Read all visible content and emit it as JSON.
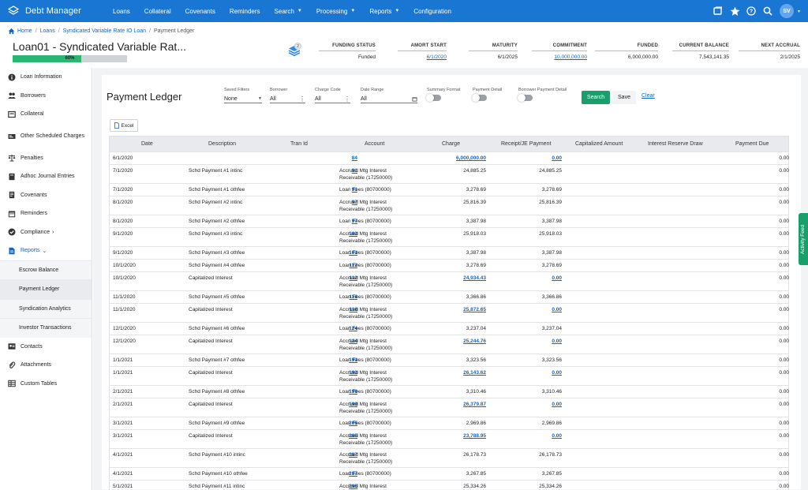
{
  "app": {
    "brand": "Debt Manager",
    "nav": [
      "Loans",
      "Collateral",
      "Covenants",
      "Reminders",
      "Search",
      "Processing",
      "Reports",
      "Configuration"
    ],
    "nav_caret": [
      false,
      false,
      false,
      false,
      true,
      true,
      true,
      false
    ],
    "avatar_initials": "SV",
    "accent_color": "#1976d2"
  },
  "breadcrumb": {
    "home": "Home",
    "loans": "Loans",
    "loan": "Syndicated Variable Rate IO Loan",
    "current": "Payment Ledger"
  },
  "loan": {
    "title": "Loan01 - Syndicated Variable Rat...",
    "progress_percent": 60,
    "progress_label": "60%",
    "badge_count": "2",
    "stats": [
      {
        "label": "FUNDING STATUS",
        "value": "Funded",
        "link": false
      },
      {
        "label": "AMORT START",
        "value": "6/1/2020",
        "link": true
      },
      {
        "label": "MATURITY",
        "value": "6/1/2025",
        "link": false
      },
      {
        "label": "COMMITMENT",
        "value": "10,000,000.00",
        "link": true
      },
      {
        "label": "FUNDED",
        "value": "6,000,000.00",
        "link": false
      },
      {
        "label": "CURRENT BALANCE",
        "value": "7,543,141.35",
        "link": false
      },
      {
        "label": "NEXT ACCRUAL",
        "value": "2/1/2025",
        "link": false
      }
    ]
  },
  "sidebar": {
    "items": [
      {
        "label": "Loan Information",
        "icon": "info-icon"
      },
      {
        "label": "Borrowers",
        "icon": "users-icon"
      },
      {
        "label": "Collateral",
        "icon": "collateral-icon"
      },
      {
        "label": "Other Scheduled Charges",
        "icon": "charges-icon"
      },
      {
        "label": "Penalties",
        "icon": "scale-icon"
      },
      {
        "label": "Adhoc Journal Entries",
        "icon": "journal-icon"
      },
      {
        "label": "Covenants",
        "icon": "covenant-icon"
      },
      {
        "label": "Reminders",
        "icon": "calendar-icon"
      },
      {
        "label": "Compliance",
        "icon": "compliance-icon"
      },
      {
        "label": "Reports",
        "icon": "reports-icon"
      }
    ],
    "report_sub": [
      "Escrow Balance",
      "Payment Ledger",
      "Syndication Analytics",
      "Investor Transactions"
    ],
    "items_after": [
      {
        "label": "Contacts",
        "icon": "contacts-icon"
      },
      {
        "label": "Attachments",
        "icon": "paperclip-icon"
      },
      {
        "label": "Custom Tables",
        "icon": "table-icon"
      }
    ]
  },
  "ledger": {
    "title": "Payment Ledger",
    "filters": {
      "saved_filters_label": "Saved Filters",
      "saved_filters_value": "None",
      "borrower_label": "Borrower",
      "borrower_value": "All",
      "charge_code_label": "Charge Code",
      "charge_code_value": "All",
      "date_range_label": "Date Range",
      "date_range_value": "All",
      "summary_format_label": "Summary Format",
      "payment_detail_label": "Payment Detail",
      "borrower_payment_detail_label": "Borrower Payment Detail"
    },
    "search_label": "Search",
    "save_label": "Save",
    "clear_label": "Clear",
    "excel_label": "Excel",
    "columns": [
      "Date",
      "Description",
      "Tran Id",
      "Account",
      "Charge",
      "Receipt/JE Payment",
      "Capitalized Amount",
      "Interest Reserve Draw",
      "Payment Due"
    ],
    "rows": [
      {
        "date": "6/1/2020",
        "desc": "",
        "tran": "84",
        "acct1": "",
        "acct2": "",
        "charge": "6,000,000.00",
        "charge_link": true,
        "receipt": "0.00",
        "receipt_link": true,
        "due": "0.00"
      },
      {
        "date": "7/1/2020",
        "desc": "Schd Payment #1 intinc",
        "tran": "91",
        "acct1": "Accrued Mtg Interest",
        "acct2": "Receivable (17250000)",
        "charge": "24,885.25",
        "charge_link": false,
        "receipt": "24,885.25",
        "receipt_link": false,
        "due": "0.00"
      },
      {
        "date": "7/1/2020",
        "desc": "Schd Payment #1 othfee",
        "tran": "91",
        "acct1": "Loan Fees (80700000)",
        "acct2": "",
        "charge": "3,278.69",
        "charge_link": false,
        "receipt": "3,278.69",
        "receipt_link": false,
        "due": "0.00"
      },
      {
        "date": "8/1/2020",
        "desc": "Schd Payment #2 intinc",
        "tran": "97",
        "acct1": "Accrued Mtg Interest",
        "acct2": "Receivable (17250000)",
        "charge": "25,816.39",
        "charge_link": false,
        "receipt": "25,816.39",
        "receipt_link": false,
        "due": "0.00"
      },
      {
        "date": "8/1/2020",
        "desc": "Schd Payment #2 othfee",
        "tran": "97",
        "acct1": "Loan Fees (80700000)",
        "acct2": "",
        "charge": "3,387.98",
        "charge_link": false,
        "receipt": "3,387.98",
        "receipt_link": false,
        "due": "0.00"
      },
      {
        "date": "9/1/2020",
        "desc": "Schd Payment #3 intinc",
        "tran": "103",
        "acct1": "Accrued Mtg Interest",
        "acct2": "Receivable (17250000)",
        "charge": "25,918.03",
        "charge_link": false,
        "receipt": "25,918.03",
        "receipt_link": false,
        "due": "0.00"
      },
      {
        "date": "9/1/2020",
        "desc": "Schd Payment #3 othfee",
        "tran": "103",
        "acct1": "Loan Fees (80700000)",
        "acct2": "",
        "charge": "3,387.98",
        "charge_link": false,
        "receipt": "3,387.98",
        "receipt_link": false,
        "due": "0.00"
      },
      {
        "date": "10/1/2020",
        "desc": "Schd Payment #4 othfee",
        "tran": "112",
        "acct1": "Loan Fees (80700000)",
        "acct2": "",
        "charge": "3,278.69",
        "charge_link": false,
        "receipt": "3,278.69",
        "receipt_link": false,
        "due": "0.00"
      },
      {
        "date": "10/1/2020",
        "desc": "Capitalized Interest",
        "tran": "112",
        "acct1": "Accrued Mtg Interest",
        "acct2": "Receivable (17250000)",
        "charge": "24,934.43",
        "charge_link": true,
        "receipt": "0.00",
        "receipt_link": true,
        "due": "0.00"
      },
      {
        "date": "11/1/2020",
        "desc": "Schd Payment #5 othfee",
        "tran": "118",
        "acct1": "Loan Fees (80700000)",
        "acct2": "",
        "charge": "3,366.86",
        "charge_link": false,
        "receipt": "3,366.86",
        "receipt_link": false,
        "due": "0.00"
      },
      {
        "date": "11/1/2020",
        "desc": "Capitalized Interest",
        "tran": "118",
        "acct1": "Accrued Mtg Interest",
        "acct2": "Receivable (17250000)",
        "charge": "25,872.65",
        "charge_link": true,
        "receipt": "0.00",
        "receipt_link": true,
        "due": "0.00"
      },
      {
        "date": "12/1/2020",
        "desc": "Schd Payment #6 othfee",
        "tran": "124",
        "acct1": "Loan Fees (80700000)",
        "acct2": "",
        "charge": "3,237.04",
        "charge_link": false,
        "receipt": "3,237.04",
        "receipt_link": false,
        "due": "0.00"
      },
      {
        "date": "12/1/2020",
        "desc": "Capitalized Interest",
        "tran": "124",
        "acct1": "Accrued Mtg Interest",
        "acct2": "Receivable (17250000)",
        "charge": "25,244.76",
        "charge_link": true,
        "receipt": "0.00",
        "receipt_link": true,
        "due": "0.00"
      },
      {
        "date": "1/1/2021",
        "desc": "Schd Payment #7 othfee",
        "tran": "193",
        "acct1": "Loan Fees (80700000)",
        "acct2": "",
        "charge": "3,323.56",
        "charge_link": false,
        "receipt": "3,323.56",
        "receipt_link": false,
        "due": "0.00"
      },
      {
        "date": "1/1/2021",
        "desc": "Capitalized Interest",
        "tran": "193",
        "acct1": "Accrued Mtg Interest",
        "acct2": "Receivable (17250000)",
        "charge": "26,143.62",
        "charge_link": true,
        "receipt": "0.00",
        "receipt_link": true,
        "due": "0.00"
      },
      {
        "date": "2/1/2021",
        "desc": "Schd Payment #8 othfee",
        "tran": "199",
        "acct1": "Loan Fees (80700000)",
        "acct2": "",
        "charge": "3,310.46",
        "charge_link": false,
        "receipt": "3,310.46",
        "receipt_link": false,
        "due": "0.00"
      },
      {
        "date": "2/1/2021",
        "desc": "Capitalized Interest",
        "tran": "199",
        "acct1": "Accrued Mtg Interest",
        "acct2": "Receivable (17250000)",
        "charge": "26,379.87",
        "charge_link": true,
        "receipt": "0.00",
        "receipt_link": true,
        "due": "0.00"
      },
      {
        "date": "3/1/2021",
        "desc": "Schd Payment #9 othfee",
        "tran": "205",
        "acct1": "Loan Fees (80700000)",
        "acct2": "",
        "charge": "2,969.86",
        "charge_link": false,
        "receipt": "2,969.86",
        "receipt_link": false,
        "due": "0.00"
      },
      {
        "date": "3/1/2021",
        "desc": "Capitalized Interest",
        "tran": "205",
        "acct1": "Accrued Mtg Interest",
        "acct2": "Receivable (17250000)",
        "charge": "23,788.95",
        "charge_link": true,
        "receipt": "0.00",
        "receipt_link": true,
        "due": "0.00"
      },
      {
        "date": "4/1/2021",
        "desc": "Schd Payment #10 intinc",
        "tran": "287",
        "acct1": "Accrued Mtg Interest",
        "acct2": "Receivable (17250000)",
        "charge": "26,178.73",
        "charge_link": false,
        "receipt": "26,178.73",
        "receipt_link": false,
        "due": "0.00"
      },
      {
        "date": "4/1/2021",
        "desc": "Schd Payment #10 othfee",
        "tran": "287",
        "acct1": "Loan Fees (80700000)",
        "acct2": "",
        "charge": "3,267.85",
        "charge_link": false,
        "receipt": "3,267.85",
        "receipt_link": false,
        "due": "0.00"
      },
      {
        "date": "5/1/2021",
        "desc": "Schd Payment #11 intinc",
        "tran": "295",
        "acct1": "Accrued Mtg Interest",
        "acct2": "Receivable (17250000)",
        "charge": "25,334.26",
        "charge_link": false,
        "receipt": "25,334.26",
        "receipt_link": false,
        "due": "0.00"
      }
    ]
  },
  "activity_feed": "Activity Feed"
}
